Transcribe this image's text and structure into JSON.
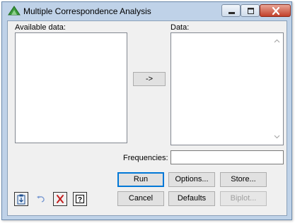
{
  "window": {
    "title": "Multiple Correspondence Analysis"
  },
  "caption_buttons": [
    "minimize-icon",
    "maximize-icon",
    "close-icon"
  ],
  "available": {
    "label": "Available data:",
    "items": []
  },
  "transfer": {
    "label": "->"
  },
  "data_list": {
    "label": "Data:",
    "items": []
  },
  "frequencies": {
    "label": "Frequencies:",
    "value": ""
  },
  "buttons": {
    "run": "Run",
    "options": "Options...",
    "store": "Store...",
    "cancel": "Cancel",
    "defaults": "Defaults",
    "biplot": "Biplot..."
  },
  "toolbar": {
    "icons": [
      "clipboard-icon",
      "undo-icon",
      "clear-icon",
      "help-icon"
    ]
  },
  "colors": {
    "titlebar": "#bfd2e8",
    "client_bg": "#f0f0f0",
    "close_button": "#c2402a",
    "default_border": "#0078d7",
    "disabled_text": "#a0a0a0"
  }
}
